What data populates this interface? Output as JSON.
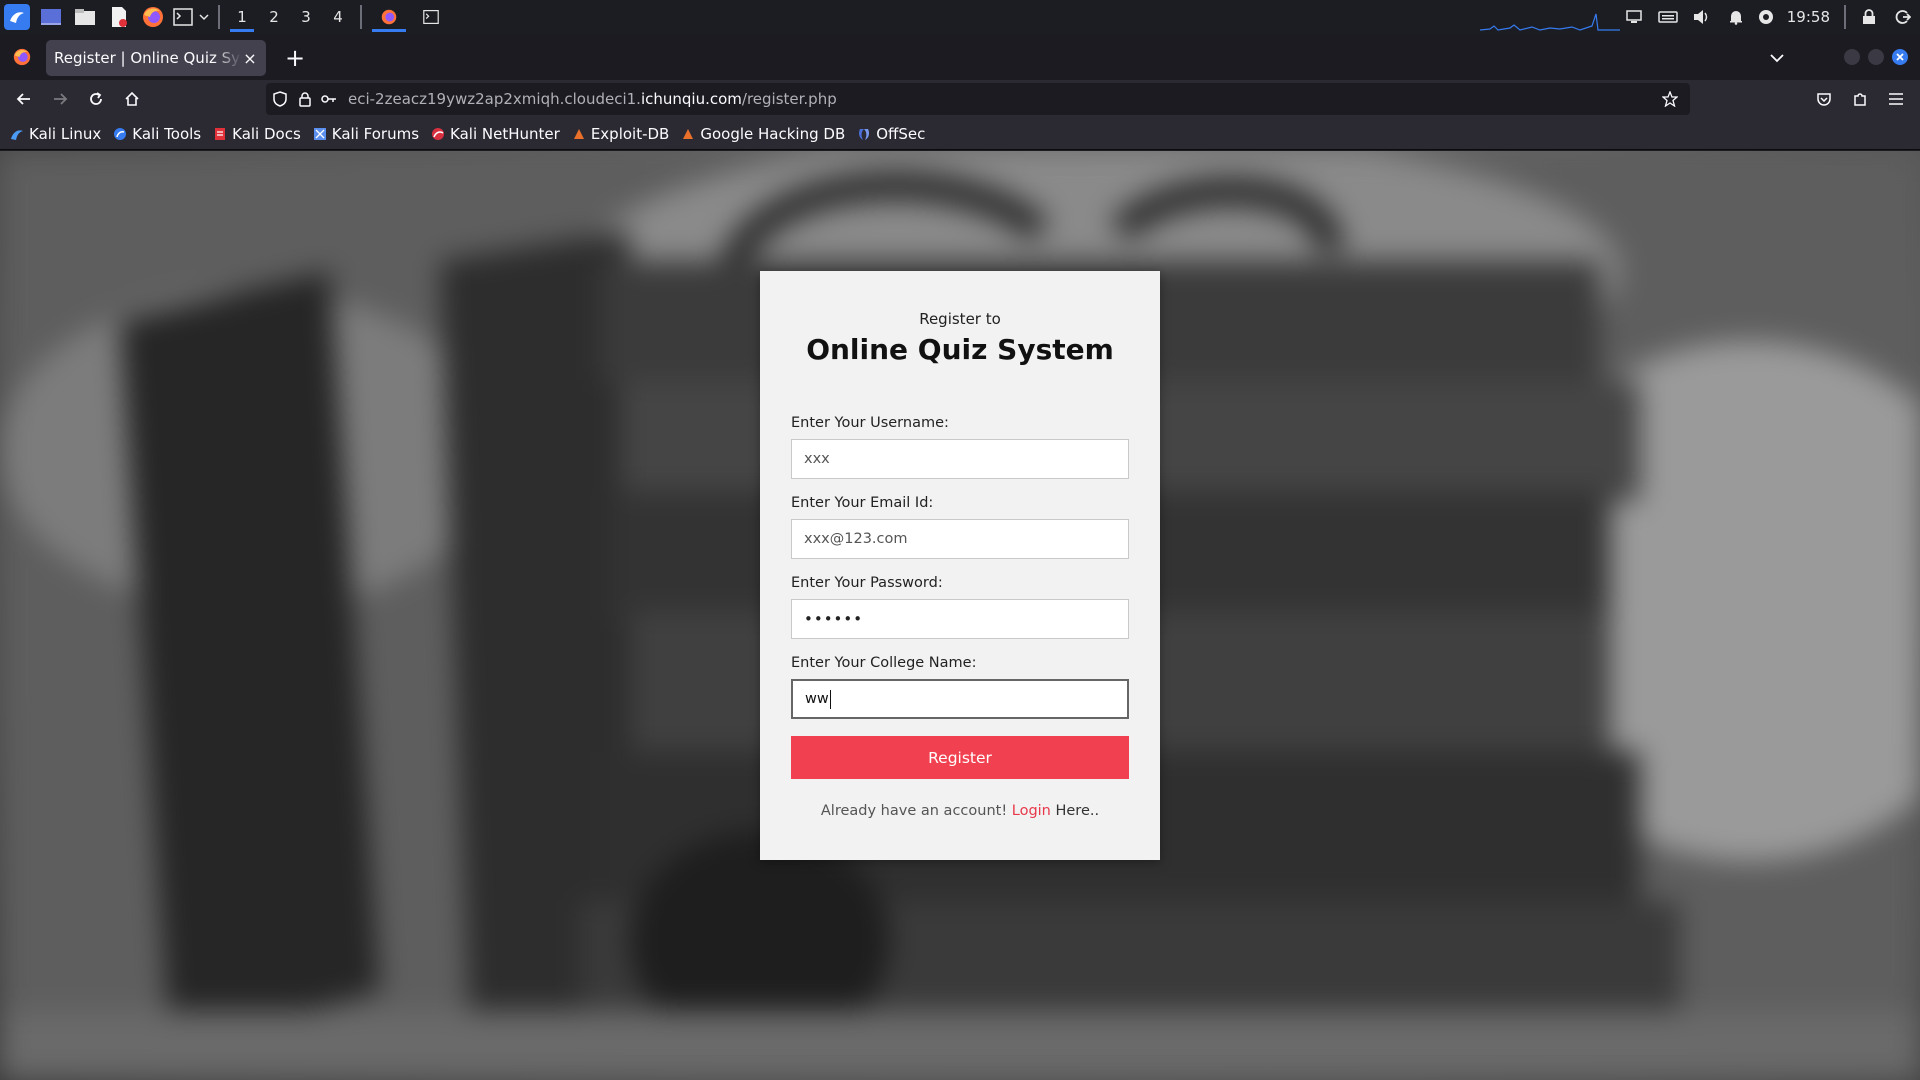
{
  "panel": {
    "workspaces": [
      "1",
      "2",
      "3",
      "4"
    ],
    "clock": "19:58"
  },
  "browser": {
    "tab_title": "Register | Online Quiz System",
    "tab_close": "×",
    "new_tab": "+",
    "url_prefix": "eci-2zeacz19ywz2ap2xmiqh.cloudeci1.",
    "url_domain": "ichunqiu.com",
    "url_path": "/register.php",
    "bookmarks": [
      {
        "label": "Kali Linux",
        "color": "#4b9bf5"
      },
      {
        "label": "Kali Tools",
        "color": "#367bf0"
      },
      {
        "label": "Kali Docs",
        "color": "#e0303a"
      },
      {
        "label": "Kali Forums",
        "color": "#5a8ff0"
      },
      {
        "label": "Kali NetHunter",
        "color": "#d93040"
      },
      {
        "label": "Exploit-DB",
        "color": "#e8702a"
      },
      {
        "label": "Google Hacking DB",
        "color": "#e8702a"
      },
      {
        "label": "OffSec",
        "color": "#4a6fd8"
      }
    ]
  },
  "form": {
    "subtitle": "Register to",
    "title": "Online Quiz System",
    "username_label": "Enter Your Username:",
    "username_value": "xxx",
    "email_label": "Enter Your Email Id:",
    "email_value": "xxx@123.com",
    "password_label": "Enter Your Password:",
    "password_value": "••••••",
    "college_label": "Enter Your College Name:",
    "college_value": "ww",
    "register_label": "Register",
    "login_prefix": "Already have an account! ",
    "login_link": "Login",
    "login_suffix": " Here.."
  },
  "colors": {
    "accent": "#367bf0",
    "register_button": "#f1404f",
    "login_link": "#e8394b"
  }
}
